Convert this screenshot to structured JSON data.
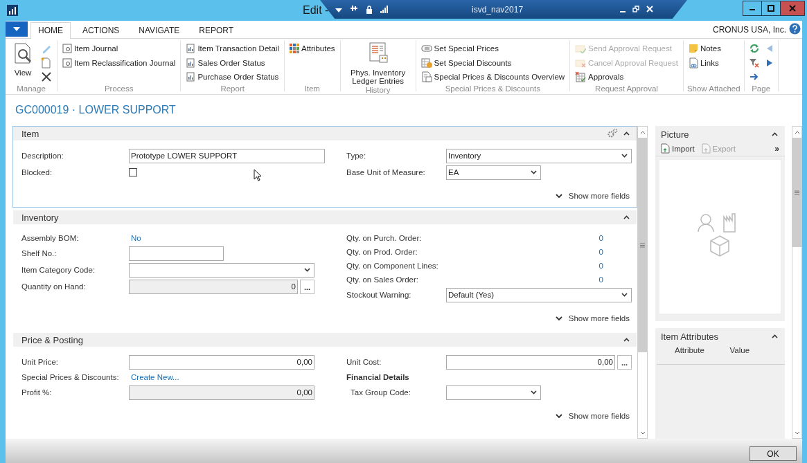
{
  "window": {
    "title": "Edit -",
    "remote_session": {
      "host": "isvd_nav2017"
    }
  },
  "ribbon": {
    "tabs": [
      {
        "label": "HOME",
        "selected": true
      },
      {
        "label": "ACTIONS",
        "selected": false
      },
      {
        "label": "NAVIGATE",
        "selected": false
      },
      {
        "label": "REPORT",
        "selected": false
      }
    ],
    "company": "CRONUS USA, Inc.",
    "groups": [
      {
        "name": "Manage",
        "items": [
          {
            "kind": "large",
            "label": "View",
            "disabled": false
          },
          {
            "kind": "icon",
            "disabled": false
          },
          {
            "kind": "icon",
            "disabled": false
          },
          {
            "kind": "icon",
            "disabled": false
          }
        ]
      },
      {
        "name": "Process",
        "items": [
          {
            "kind": "small",
            "label": "Item Journal",
            "disabled": false
          },
          {
            "kind": "small",
            "label": "Item Reclassification Journal",
            "disabled": false
          }
        ]
      },
      {
        "name": "Report",
        "items": [
          {
            "kind": "small",
            "label": "Item Transaction Detail",
            "disabled": false
          },
          {
            "kind": "small",
            "label": "Sales Order Status",
            "disabled": false
          },
          {
            "kind": "small",
            "label": "Purchase Order Status",
            "disabled": false
          }
        ]
      },
      {
        "name": "Item",
        "items": [
          {
            "kind": "small",
            "label": "Attributes",
            "disabled": false
          }
        ]
      },
      {
        "name": "History",
        "items": [
          {
            "kind": "large",
            "label": "Phys. Inventory Ledger Entries",
            "disabled": false
          }
        ]
      },
      {
        "name": "Special Prices & Discounts",
        "items": [
          {
            "kind": "small",
            "label": "Set Special Prices",
            "disabled": false
          },
          {
            "kind": "small",
            "label": "Set Special Discounts",
            "disabled": false
          },
          {
            "kind": "small",
            "label": "Special Prices & Discounts Overview",
            "disabled": false
          }
        ]
      },
      {
        "name": "Request Approval",
        "items": [
          {
            "kind": "small",
            "label": "Send Approval Request",
            "disabled": true
          },
          {
            "kind": "small",
            "label": "Cancel Approval Request",
            "disabled": true
          },
          {
            "kind": "small",
            "label": "Approvals",
            "disabled": false
          }
        ]
      },
      {
        "name": "Show Attached",
        "items": [
          {
            "kind": "small",
            "label": "Notes",
            "disabled": false
          },
          {
            "kind": "small",
            "label": "Links",
            "disabled": false
          }
        ]
      },
      {
        "name": "Page",
        "items": [
          {
            "kind": "icon",
            "disabled": false
          },
          {
            "kind": "icon",
            "disabled": false
          },
          {
            "kind": "icon",
            "disabled": false
          },
          {
            "kind": "icon",
            "disabled": true
          },
          {
            "kind": "icon",
            "disabled": false
          }
        ]
      }
    ]
  },
  "page_title": "GC000019 · LOWER SUPPORT",
  "sections": [
    {
      "title": "Item",
      "expanded": true,
      "focused": true,
      "fields_left": [
        {
          "kind": "widetext",
          "label": "Description:",
          "value": "Prototype LOWER SUPPORT"
        },
        {
          "kind": "checkbox",
          "label": "Blocked:",
          "checked": false
        }
      ],
      "fields_right": [
        {
          "kind": "select",
          "label": "Type:",
          "value": "Inventory"
        },
        {
          "kind": "shortselect",
          "label": "Base Unit of Measure:",
          "value": "EA"
        }
      ],
      "show_more": "Show more fields"
    },
    {
      "title": "Inventory",
      "expanded": true,
      "focused": false,
      "fields_left": [
        {
          "kind": "link",
          "label": "Assembly BOM:",
          "value": "No"
        },
        {
          "kind": "shorttext",
          "label": "Shelf No.:"
        },
        {
          "kind": "select",
          "label": "Item Category Code:"
        },
        {
          "kind": "readonly",
          "label": "Quantity on Hand:",
          "value": "0",
          "assist": "..."
        }
      ],
      "fields_right": [
        {
          "kind": "count",
          "label": "Qty. on Purch. Order:",
          "value": "0"
        },
        {
          "kind": "count",
          "label": "Qty. on Prod. Order:",
          "value": "0"
        },
        {
          "kind": "count",
          "label": "Qty. on Component Lines:",
          "value": "0"
        },
        {
          "kind": "count",
          "label": "Qty. on Sales Order:",
          "value": "0"
        },
        {
          "kind": "select",
          "label": "Stockout Warning:",
          "value": "Default (Yes)"
        }
      ],
      "show_more": "Show more fields"
    },
    {
      "title": "Price & Posting",
      "expanded": true,
      "focused": false,
      "fields_left": [
        {
          "kind": "number",
          "label": "Unit Price:",
          "value": "0,00"
        },
        {
          "kind": "link",
          "label": "Special Prices & Discounts:",
          "value": "Create New..."
        },
        {
          "kind": "readonly",
          "label": "Profit %:",
          "value": "0,00"
        }
      ],
      "fields_right": [
        {
          "kind": "number",
          "label": "Unit Cost:",
          "value": "0,00",
          "assist": "..."
        },
        {
          "kind": "heading",
          "label": "Financial Details",
          "children": [
            {
              "kind": "shortselect",
              "label": "Tax Group Code:"
            }
          ]
        }
      ],
      "show_more": "Show more fields"
    }
  ],
  "factbox": {
    "picture": {
      "title": "Picture",
      "expanded": true,
      "actions": [
        {
          "label": "Import",
          "disabled": false
        },
        {
          "label": "Export",
          "disabled": true
        }
      ],
      "more": "»"
    },
    "attributes": {
      "title": "Item Attributes",
      "expanded": true,
      "columns": [
        "Attribute",
        "Value"
      ]
    }
  },
  "buttons": [
    "OK"
  ]
}
